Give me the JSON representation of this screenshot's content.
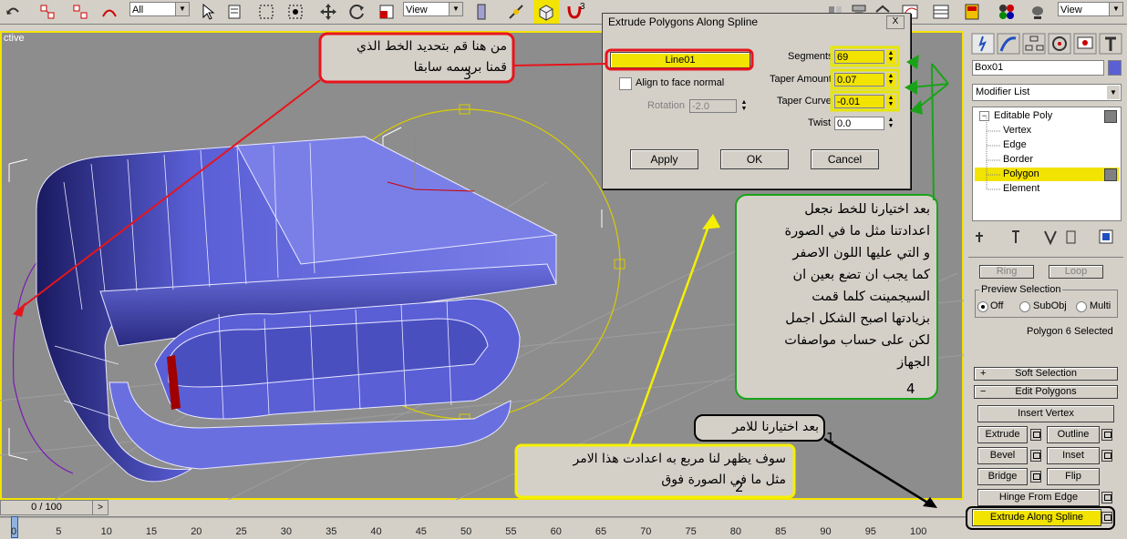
{
  "toolbar": {
    "selection_filter": "All",
    "reference_coord": "View",
    "reference_coord_right": "View",
    "snap_number": "3"
  },
  "viewport": {
    "label": "ctive",
    "time_slider": "0 / 100",
    "time_next": ">",
    "ticks": [
      "0",
      "5",
      "10",
      "15",
      "20",
      "25",
      "30",
      "35",
      "40",
      "45",
      "50",
      "55",
      "60",
      "65",
      "70",
      "75",
      "80",
      "85",
      "90",
      "95",
      "100"
    ]
  },
  "dialog": {
    "title": "Extrude Polygons Along Spline",
    "close": "X",
    "spline_button": "Line01",
    "align_label": "Align to face normal",
    "rotation_label": "Rotation",
    "rotation_value": "-2.0",
    "segments_label": "Segments",
    "segments_value": "69",
    "taper_amount_label": "Taper Amount",
    "taper_amount_value": "0.07",
    "taper_curve_label": "Taper Curve",
    "taper_curve_value": "-0.01",
    "twist_label": "Twist",
    "twist_value": "0.0",
    "apply": "Apply",
    "ok": "OK",
    "cancel": "Cancel"
  },
  "panel": {
    "object_name": "Box01",
    "modifier_list": "Modifier List",
    "stack": [
      "Editable Poly",
      "Vertex",
      "Edge",
      "Border",
      "Polygon",
      "Element"
    ],
    "ring": "Ring",
    "loop": "Loop",
    "preview_title": "Preview Selection",
    "preview_off": "Off",
    "preview_subobj": "SubObj",
    "preview_multi": "Multi",
    "selection_status": "Polygon 6 Selected",
    "soft_selection": "Soft Selection",
    "soft_sign": "+",
    "edit_polygons": "Edit Polygons",
    "edit_sign": "−",
    "insert_vertex": "Insert Vertex",
    "extrude": "Extrude",
    "outline": "Outline",
    "bevel": "Bevel",
    "inset": "Inset",
    "bridge": "Bridge",
    "flip": "Flip",
    "hinge": "Hinge From Edge",
    "extrude_spline": "Extrude Along Spline"
  },
  "annotations": {
    "note1_text": "بعد اختيارنا للامر",
    "note1_num": "1",
    "note2_line1": "سوف يظهر لنا مربع به اعدادت هذا الامر",
    "note2_line2": "مثل ما في الصورة فوق",
    "note2_num": "2",
    "note3_line1": "من هنا قم بتحديد الخط الذي",
    "note3_line2": "قمنا برسمه سابقا",
    "note3_num": "3",
    "note4_lines": [
      "بعد اختيارنا للخط نجعل",
      "اعدادتنا مثل ما في الصورة",
      "و التي عليها اللون الاصفر",
      "كما يجب ان تضع بعين ان",
      "السيجمينت كلما قمت",
      "بزيادتها اصبح الشكل اجمل",
      "لكن على حساب مواصفات",
      "الجهاز"
    ],
    "note4_num": "4"
  },
  "colors": {
    "highlight": "#f2e300",
    "red": "#e8141c",
    "green": "#1aa31a",
    "yellow_arrow": "#f5f000",
    "viewport_bg": "#8d8d8d",
    "mesh": "#5a5fd6"
  }
}
